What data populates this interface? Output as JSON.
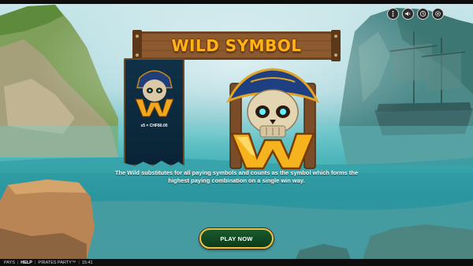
{
  "game": {
    "name": "PIRATES PARTY™"
  },
  "top_controls": [
    {
      "name": "menu-icon"
    },
    {
      "name": "sound-icon"
    },
    {
      "name": "history-icon"
    },
    {
      "name": "settings-icon"
    }
  ],
  "banner": {
    "title": "WILD SYMBOL"
  },
  "symbol": {
    "letter": "W",
    "payout": "x5 = CHF80.00"
  },
  "description": "The Wild substitutes for all paying symbols and counts as the symbol which forms the highest paying combination on a single win way.",
  "play_button": {
    "label": "PLAY NOW"
  },
  "footer": {
    "pays": "PAYS",
    "help": "HELP",
    "game": "PIRATES PARTY™",
    "time": "15:41",
    "separator": "|"
  },
  "colors": {
    "title_gold": "#ffb21c",
    "button_green": "#0c3c1a",
    "button_border": "#f0c24a",
    "sea": "#3aa6ad"
  }
}
